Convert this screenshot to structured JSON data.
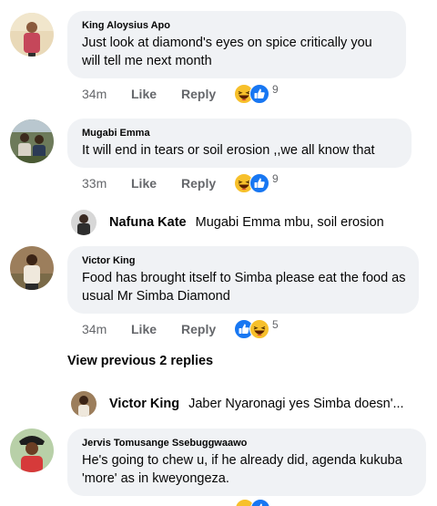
{
  "comments": [
    {
      "author": "King Aloysius Apo",
      "text": "Just look at diamond's eyes on spice critically you will tell me next month",
      "time": "34m",
      "like_label": "Like",
      "reply_label": "Reply",
      "reaction_count": "9",
      "reactions": [
        "haha-icon",
        "like-icon"
      ]
    },
    {
      "author": "Mugabi Emma",
      "text": "It will end in tears or soil erosion ,,we all know that",
      "time": "33m",
      "like_label": "Like",
      "reply_label": "Reply",
      "reaction_count": "9",
      "reactions": [
        "haha-icon",
        "like-icon"
      ]
    },
    {
      "author": "Victor King",
      "text": "Food has brought itself to Simba please eat the food as usual Mr Simba Diamond",
      "time": "34m",
      "like_label": "Like",
      "reply_label": "Reply",
      "reaction_count": "5",
      "reactions": [
        "like-icon",
        "haha-icon"
      ]
    },
    {
      "author": "Jervis Tomusange Ssebuggwaawo",
      "text": "He's going to chew u, if he already did, agenda kukuba 'more' as in kweyongeza.",
      "time": "",
      "like_label": "",
      "reply_label": "",
      "reaction_count": "",
      "reactions": [
        "haha-icon",
        "like-icon"
      ]
    }
  ],
  "replies": [
    {
      "name": "Nafuna Kate",
      "text": "Mugabi Emma mbu, soil erosion"
    },
    {
      "name": "Victor King",
      "text": "Jaber Nyaronagi yes Simba doesn'..."
    }
  ],
  "view_previous_label": "View previous 2 replies",
  "colors": {
    "bubble_bg": "#f0f2f5",
    "meta_text": "#65676b",
    "like_blue": "#1877f2",
    "haha_yellow": "#f7c02b"
  }
}
